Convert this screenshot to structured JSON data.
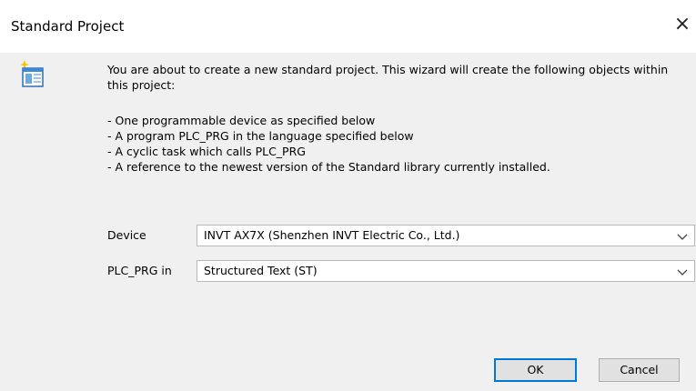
{
  "window": {
    "title": "Standard Project",
    "close_glyph": "×"
  },
  "icon": "wizard-window-icon",
  "intro_text": "You are about to create a new standard project. This wizard will create the following objects within this project:",
  "bullets": [
    "- One programmable device as specified below",
    "- A program PLC_PRG in the language specified below",
    "- A cyclic task which calls PLC_PRG",
    "- A reference to the newest version of the Standard library currently installed."
  ],
  "fields": {
    "device_label": "Device",
    "device_value": "INVT AX7X (Shenzhen INVT Electric Co., Ltd.)",
    "plc_prg_label": "PLC_PRG in",
    "plc_prg_value": "Structured Text (ST)"
  },
  "buttons": {
    "ok": "OK",
    "cancel": "Cancel"
  },
  "colors": {
    "focus_border": "#0078d7",
    "dialog_bg": "#f0f0f0"
  }
}
